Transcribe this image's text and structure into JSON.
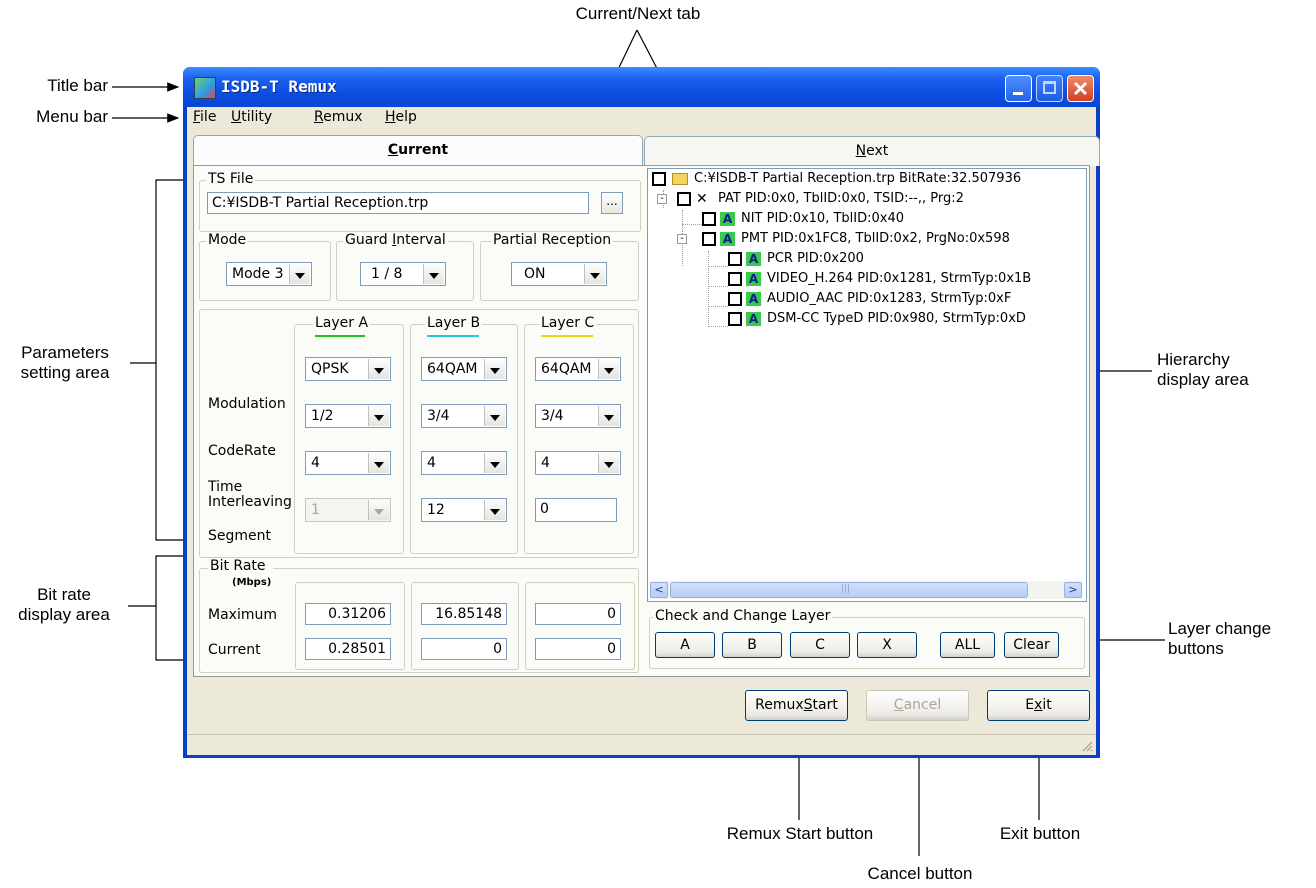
{
  "callouts": {
    "title_bar": "Title bar",
    "menu_bar": "Menu bar",
    "current_next_tab": "Current/Next tab",
    "parameters_area_1": "Parameters",
    "parameters_area_2": "setting area",
    "bit_rate_area_1": "Bit rate",
    "bit_rate_area_2": "display area",
    "hierarchy_area_1": "Hierarchy",
    "hierarchy_area_2": "display area",
    "layer_change_1": "Layer change",
    "layer_change_2": "buttons",
    "remux_start": "Remux Start button",
    "cancel": "Cancel button",
    "exit": "Exit button"
  },
  "window": {
    "title": "ISDB-T Remux"
  },
  "menu": {
    "items": [
      {
        "label": "File",
        "mnemonic": "F",
        "rest": "ile"
      },
      {
        "label": "Utility",
        "mnemonic": "U",
        "rest": "tility"
      },
      {
        "label": "Remux",
        "mnemonic": "R",
        "rest": "emux"
      },
      {
        "label": "Help",
        "mnemonic": "H",
        "rest": "elp"
      }
    ]
  },
  "tabs": {
    "current": {
      "mnemonic": "C",
      "rest": "urrent"
    },
    "next": {
      "mnemonic": "N",
      "rest": "ext"
    }
  },
  "ts_file": {
    "group_title": "TS File",
    "path": "C:¥ISDB-T Partial Reception.trp",
    "browse_label": "..."
  },
  "mode": {
    "group_title": "Mode",
    "value": "Mode 3"
  },
  "guard_interval": {
    "group_title": "Guard Interval",
    "mnemonic": "I",
    "prefix": "Guard ",
    "rest": "nterval",
    "value": "1 / 8"
  },
  "partial_reception": {
    "group_title": "Partial Reception",
    "value": "ON"
  },
  "layers": {
    "headers": [
      "Layer A",
      "Layer B",
      "Layer C"
    ],
    "underline_colors": [
      "#22c21e",
      "#26c9d8",
      "#e8d81a"
    ],
    "row_labels": {
      "modulation": "Modulation",
      "coderate": "CodeRate",
      "time_1": "Time",
      "time_2": "Interleaving",
      "segment": "Segment"
    },
    "modulation": [
      "QPSK",
      "64QAM",
      "64QAM"
    ],
    "coderate": [
      "1/2",
      "3/4",
      "3/4"
    ],
    "interleaving": [
      "4",
      "4",
      "4"
    ],
    "segment": [
      "1",
      "12",
      "0"
    ]
  },
  "bit_rate": {
    "group_title": "Bit Rate",
    "unit": "(Mbps)",
    "maximum_label": "Maximum",
    "current_label": "Current",
    "maximum": [
      "0.31206",
      "16.85148",
      "0"
    ],
    "current": [
      "0.28501",
      "0",
      "0"
    ]
  },
  "tree": {
    "rows": [
      {
        "text": "C:¥ISDB-T Partial Reception.trp  BitRate:32.507936",
        "icon": "folder"
      },
      {
        "text": "PAT PID:0x0, TblID:0x0, TSID:--,, Prg:2",
        "icon": "x"
      },
      {
        "text": "NIT PID:0x10, TblID:0x40",
        "icon": "A"
      },
      {
        "text": "PMT PID:0x1FC8, TblID:0x2, PrgNo:0x598",
        "icon": "A"
      },
      {
        "text": "PCR PID:0x200",
        "icon": "A"
      },
      {
        "text": "VIDEO_H.264 PID:0x1281, StrmTyp:0x1B",
        "icon": "A"
      },
      {
        "text": "AUDIO_AAC PID:0x1283, StrmTyp:0xF",
        "icon": "A"
      },
      {
        "text": "DSM-CC TypeD PID:0x980, StrmTyp:0xD",
        "icon": "A"
      }
    ],
    "badge_label": "A",
    "x_glyph": "✕",
    "expander": "-",
    "scroll_left": "<",
    "scroll_right": ">",
    "scroll_grip": "|||"
  },
  "layer_change": {
    "group_title": "Check and Change Layer",
    "buttons": [
      "A",
      "B",
      "C",
      "X",
      "ALL",
      "Clear"
    ]
  },
  "actions": {
    "remux_start": {
      "prefix": "Remux",
      "mnemonic": "S",
      "rest": "tart"
    },
    "cancel": {
      "mnemonic": "C",
      "rest": "ancel"
    },
    "exit": {
      "prefix": "E",
      "mnemonic": "x",
      "rest": "it"
    }
  }
}
